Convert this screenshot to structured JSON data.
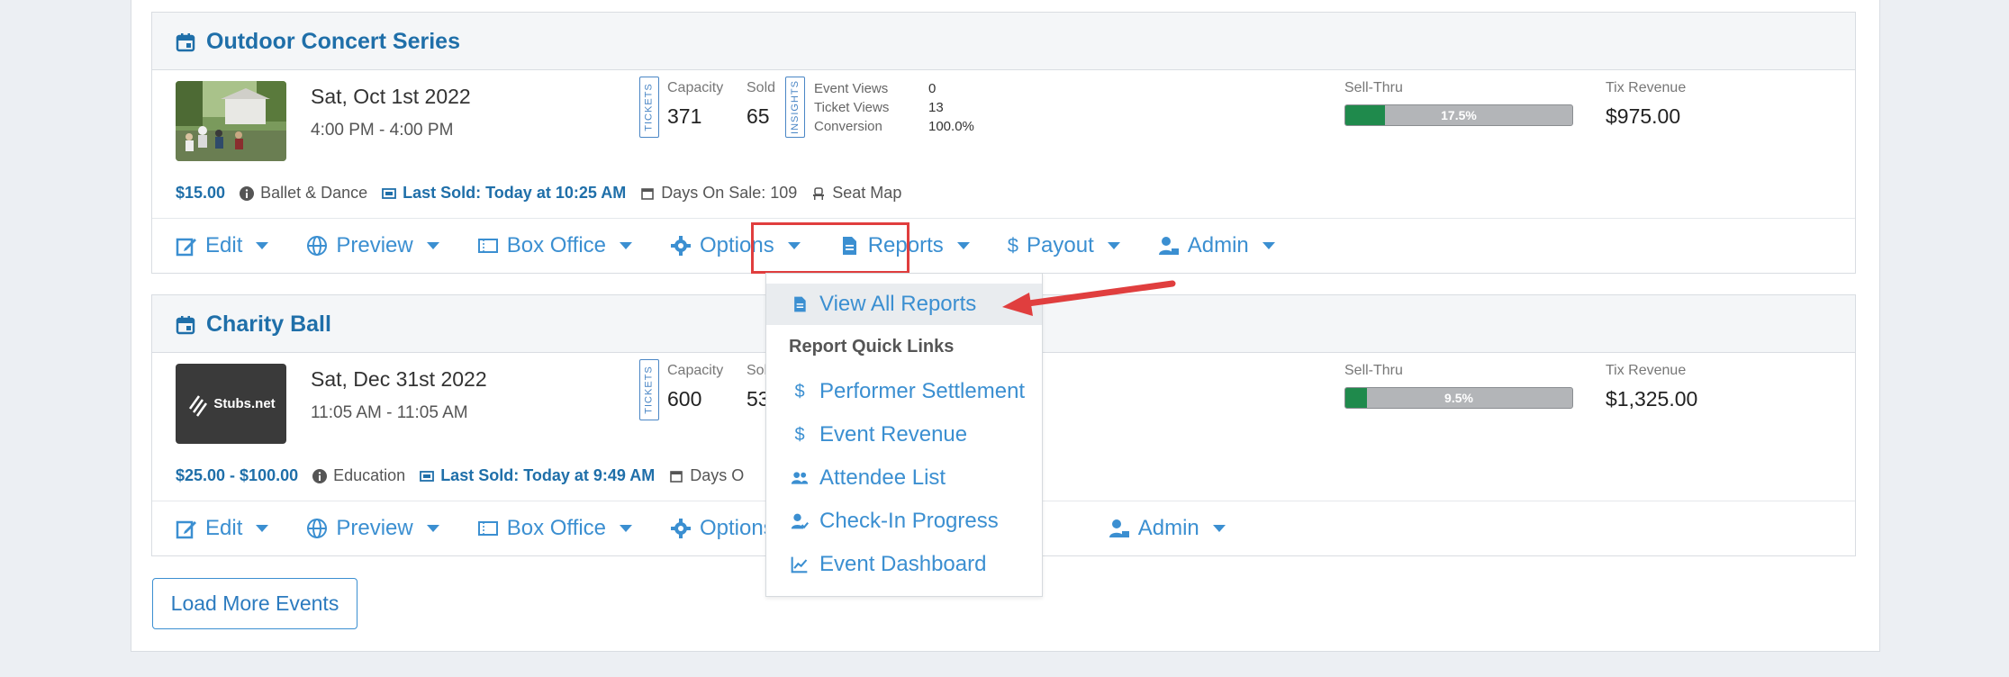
{
  "events": [
    {
      "title": "Outdoor Concert Series",
      "date": "Sat, Oct 1st 2022",
      "time": "4:00 PM - 4:00 PM",
      "tickets_tag": "TICKETS",
      "insights_tag": "INSIGHTS",
      "capacity_label": "Capacity",
      "capacity": "371",
      "sold_label": "Sold",
      "sold": "65",
      "insights": [
        {
          "label": "Event Views",
          "value": "0"
        },
        {
          "label": "Ticket Views",
          "value": "13"
        },
        {
          "label": "Conversion",
          "value": "100.0%"
        }
      ],
      "sellthru_label": "Sell-Thru",
      "sellthru": "17.5%",
      "sellthru_fraction": 0.175,
      "revenue_label": "Tix Revenue",
      "revenue": "$975.00",
      "price": "$15.00",
      "category": "Ballet & Dance",
      "last_sold": "Last Sold: Today at 10:25 AM",
      "days_on_sale": "Days On Sale: 109",
      "seat_map": "Seat Map"
    },
    {
      "title": "Charity Ball",
      "date": "Sat, Dec 31st 2022",
      "time": "11:05 AM - 11:05 AM",
      "tickets_tag": "TICKETS",
      "capacity_label": "Capacity",
      "capacity": "600",
      "sold_label": "Sol",
      "sold": "53",
      "sellthru_label": "Sell-Thru",
      "sellthru": "9.5%",
      "sellthru_fraction": 0.095,
      "revenue_label": "Tix Revenue",
      "revenue": "$1,325.00",
      "price": "$25.00 - $100.00",
      "category": "Education",
      "last_sold": "Last Sold: Today at 9:49 AM",
      "days_on_sale": "Days O",
      "logo_text": "Stubs.net"
    }
  ],
  "toolbar": {
    "edit": "Edit",
    "preview": "Preview",
    "box_office": "Box Office",
    "options": "Options",
    "reports": "Reports",
    "payout": "Payout",
    "admin": "Admin"
  },
  "reports_menu": {
    "view_all": "View All Reports",
    "header": "Report Quick Links",
    "items": [
      "Performer Settlement",
      "Event Revenue",
      "Attendee List",
      "Check-In Progress",
      "Event Dashboard"
    ]
  },
  "load_more": "Load More Events",
  "colors": {
    "accent": "#3b8fd1",
    "title": "#1f6fa9",
    "highlight": "#e03e3e",
    "sellthru_fill": "#1f8a4c"
  }
}
